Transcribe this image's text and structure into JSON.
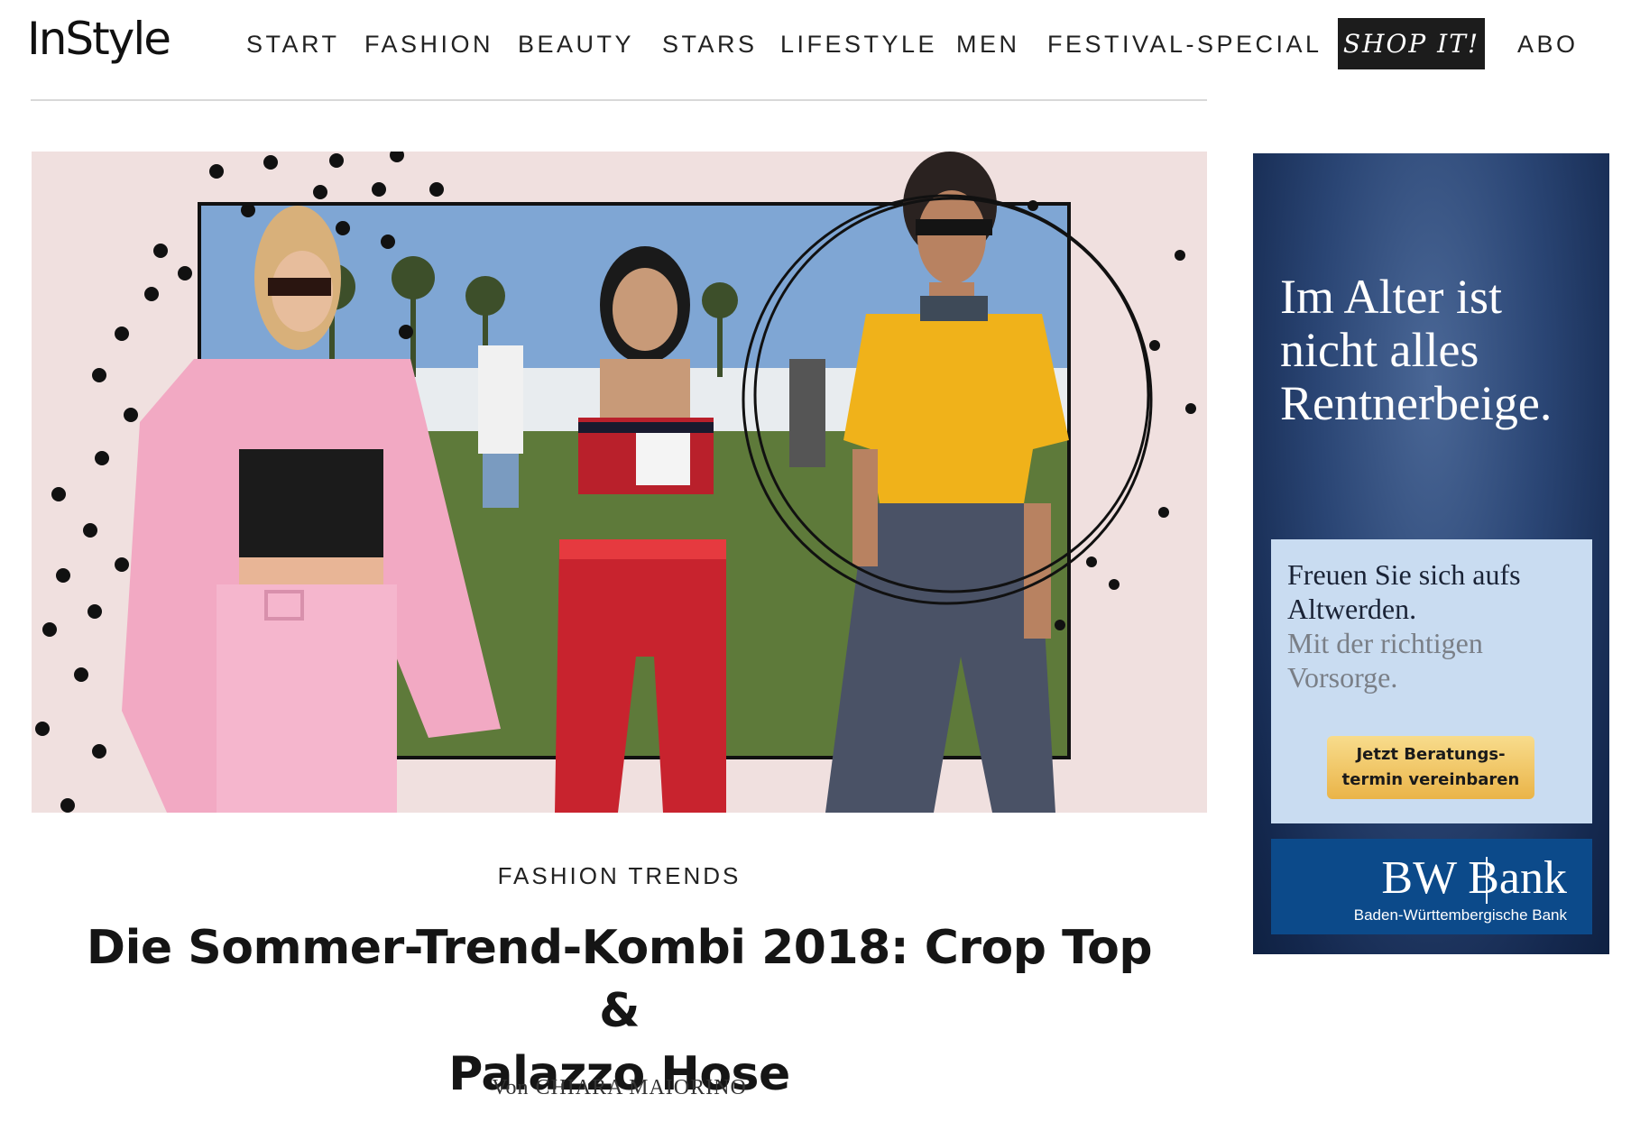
{
  "header": {
    "logo": "InStyle",
    "nav": [
      "START",
      "FASHION",
      "BEAUTY",
      "STARS",
      "LIFESTYLE",
      "MEN",
      "FESTIVAL-SPECIAL"
    ],
    "shop_label": "SHOP IT!",
    "abo_label": "ABO"
  },
  "article": {
    "kicker": "FASHION TRENDS",
    "headline_line1": "Die Sommer-Trend-Kombi 2018: Crop Top &",
    "headline_line2": "Palazzo Hose",
    "byline": "Von CHIARA MAIORINO"
  },
  "ad": {
    "headline": [
      "Im Alter ist",
      "nicht alles",
      "Rentnerbeige."
    ],
    "box_line1": "Freuen Sie sich aufs",
    "box_line2": "Altwerden.",
    "box_line3": "Mit der richtigen",
    "box_line4": "Vorsorge.",
    "cta_line1": "Jetzt Beratungs-",
    "cta_line2": "termin vereinbaren",
    "bank_name": "BW Bank",
    "bank_sub": "Baden-Württembergische Bank"
  },
  "colors": {
    "hero_bg": "#f0e0df",
    "ad_navy": "#14284e",
    "ad_light": "#c9dcf1",
    "cta_gold": "#eab448",
    "bank_blue": "#0c4a8a"
  }
}
